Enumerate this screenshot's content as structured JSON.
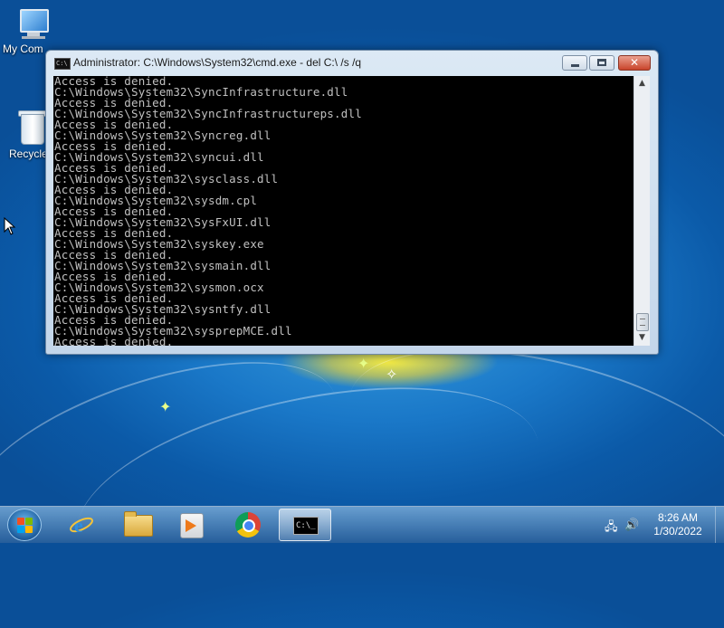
{
  "desktop": {
    "icons": [
      {
        "label": "My Com",
        "name": "my-computer"
      },
      {
        "label": "Recycle",
        "name": "recycle-bin"
      }
    ]
  },
  "window": {
    "title": "Administrator: C:\\Windows\\System32\\cmd.exe - del  C:\\ /s /q",
    "icon": "cmd-icon",
    "controls": {
      "close_glyph": "✕"
    }
  },
  "console": {
    "lines": [
      "Access is denied.",
      "C:\\Windows\\System32\\SyncInfrastructure.dll",
      "Access is denied.",
      "C:\\Windows\\System32\\SyncInfrastructureps.dll",
      "Access is denied.",
      "C:\\Windows\\System32\\Syncreg.dll",
      "Access is denied.",
      "C:\\Windows\\System32\\syncui.dll",
      "Access is denied.",
      "C:\\Windows\\System32\\sysclass.dll",
      "Access is denied.",
      "C:\\Windows\\System32\\sysdm.cpl",
      "Access is denied.",
      "C:\\Windows\\System32\\SysFxUI.dll",
      "Access is denied.",
      "C:\\Windows\\System32\\syskey.exe",
      "Access is denied.",
      "C:\\Windows\\System32\\sysmain.dll",
      "Access is denied.",
      "C:\\Windows\\System32\\sysmon.ocx",
      "Access is denied.",
      "C:\\Windows\\System32\\sysntfy.dll",
      "Access is denied.",
      "C:\\Windows\\System32\\sysprepMCE.dll",
      "Access is denied."
    ]
  },
  "taskbar": {
    "pinned": [
      "internet-explorer",
      "windows-explorer",
      "windows-media-player",
      "google-chrome",
      "command-prompt"
    ],
    "active": "command-prompt",
    "clock": {
      "time": "8:26 AM",
      "date": "1/30/2022"
    }
  },
  "colors": {
    "console_bg": "#000000",
    "console_fg": "#c0c0c0",
    "close_button": "#c8442b"
  }
}
